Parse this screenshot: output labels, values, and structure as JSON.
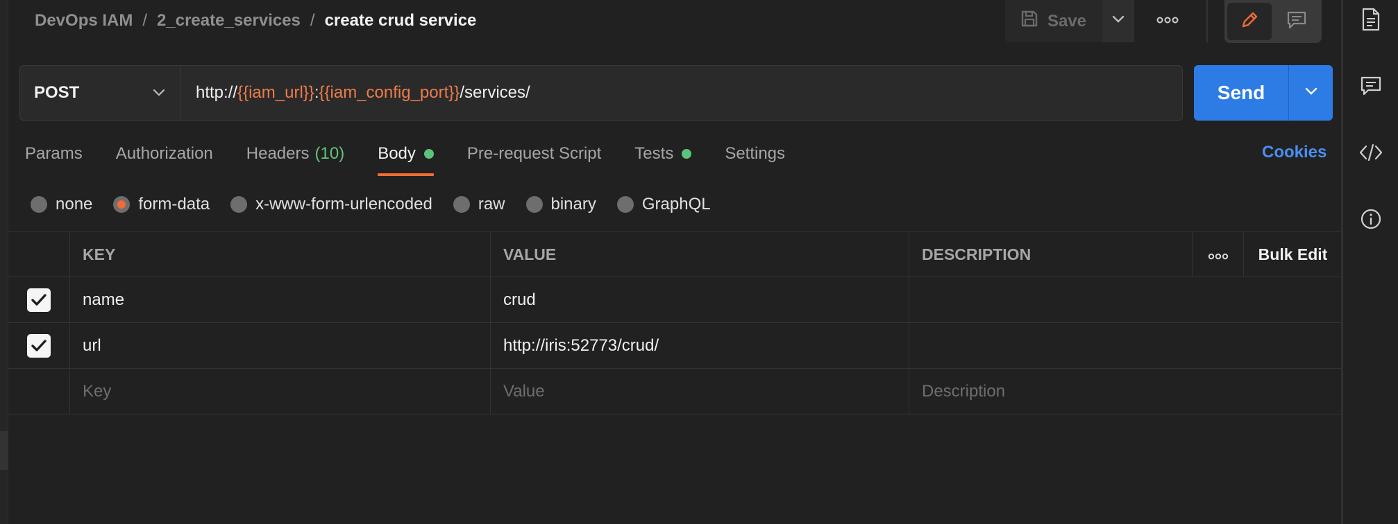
{
  "breadcrumb": {
    "items": [
      "DevOps IAM",
      "2_create_services"
    ],
    "separator": "/",
    "current": "create crud service"
  },
  "toolbar": {
    "save_label": "Save",
    "save_icon": "floppy-disk-icon",
    "more_icon": "ellipsis-icon",
    "edit_mode_icon": "pencil-icon",
    "comment_mode_icon": "comment-icon"
  },
  "request": {
    "method": "POST",
    "url_parts": [
      {
        "text": "http://",
        "var": false
      },
      {
        "text": "{{iam_url}}",
        "var": true
      },
      {
        "text": ":",
        "var": false
      },
      {
        "text": "{{iam_config_port}}",
        "var": true
      },
      {
        "text": "/services/",
        "var": false
      }
    ],
    "send_label": "Send"
  },
  "tabs": [
    {
      "label": "Params"
    },
    {
      "label": "Authorization"
    },
    {
      "label": "Headers",
      "count": "(10)"
    },
    {
      "label": "Body",
      "dot": true,
      "active": true
    },
    {
      "label": "Pre-request Script"
    },
    {
      "label": "Tests",
      "dot": true
    },
    {
      "label": "Settings"
    }
  ],
  "cookies_label": "Cookies",
  "body_types": [
    {
      "label": "none",
      "checked": false
    },
    {
      "label": "form-data",
      "checked": true
    },
    {
      "label": "x-www-form-urlencoded",
      "checked": false
    },
    {
      "label": "raw",
      "checked": false
    },
    {
      "label": "binary",
      "checked": false
    },
    {
      "label": "GraphQL",
      "checked": false
    }
  ],
  "table": {
    "headers": {
      "key": "KEY",
      "value": "VALUE",
      "description": "DESCRIPTION",
      "bulk_edit": "Bulk Edit"
    },
    "rows": [
      {
        "checked": true,
        "key": "name",
        "value": "crud",
        "description": ""
      },
      {
        "checked": true,
        "key": "url",
        "value": "http://iris:52773/crud/",
        "description": ""
      }
    ],
    "placeholders": {
      "key": "Key",
      "value": "Value",
      "description": "Description"
    }
  },
  "sidebar_icons": [
    "document-icon",
    "comments-icon",
    "code-icon",
    "info-icon"
  ],
  "colors": {
    "background": "#212121",
    "accent_orange": "#ef6c35",
    "variable": "#ef7b4b",
    "send_blue": "#2d7be5",
    "status_green": "#5cc37a",
    "link_blue": "#4b8ef0"
  }
}
